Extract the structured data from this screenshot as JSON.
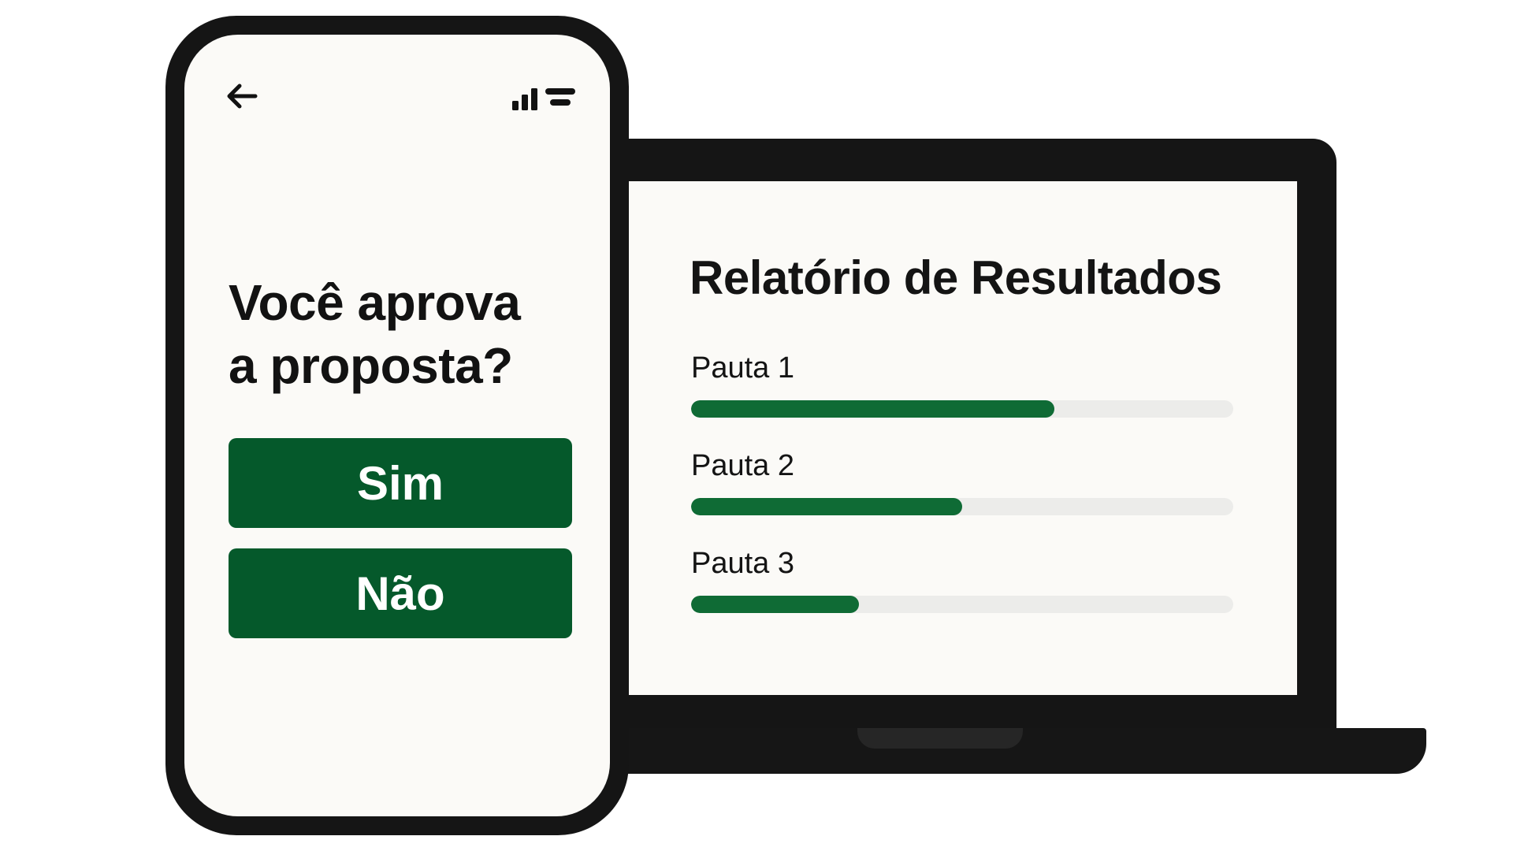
{
  "phone": {
    "question_line1": "Você aprova",
    "question_line2": "a proposta?",
    "buttons": {
      "yes_label": "Sim",
      "no_label": "Não"
    },
    "header": {
      "back_icon": "arrow-left-icon",
      "signal_icon": "signal-bars-icon",
      "menu_icon": "menu-lines-icon"
    }
  },
  "laptop": {
    "report_title": "Relatório de Resultados",
    "items": [
      {
        "label": "Pauta 1",
        "progress": 0.67
      },
      {
        "label": "Pauta 2",
        "progress": 0.5
      },
      {
        "label": "Pauta 3",
        "progress": 0.31
      }
    ]
  },
  "colors": {
    "accent_green": "#05592b",
    "bar_green": "#0f6b35",
    "track_gray": "#ececea",
    "device_black": "#151515",
    "screen_white": "#fbfaf7"
  }
}
